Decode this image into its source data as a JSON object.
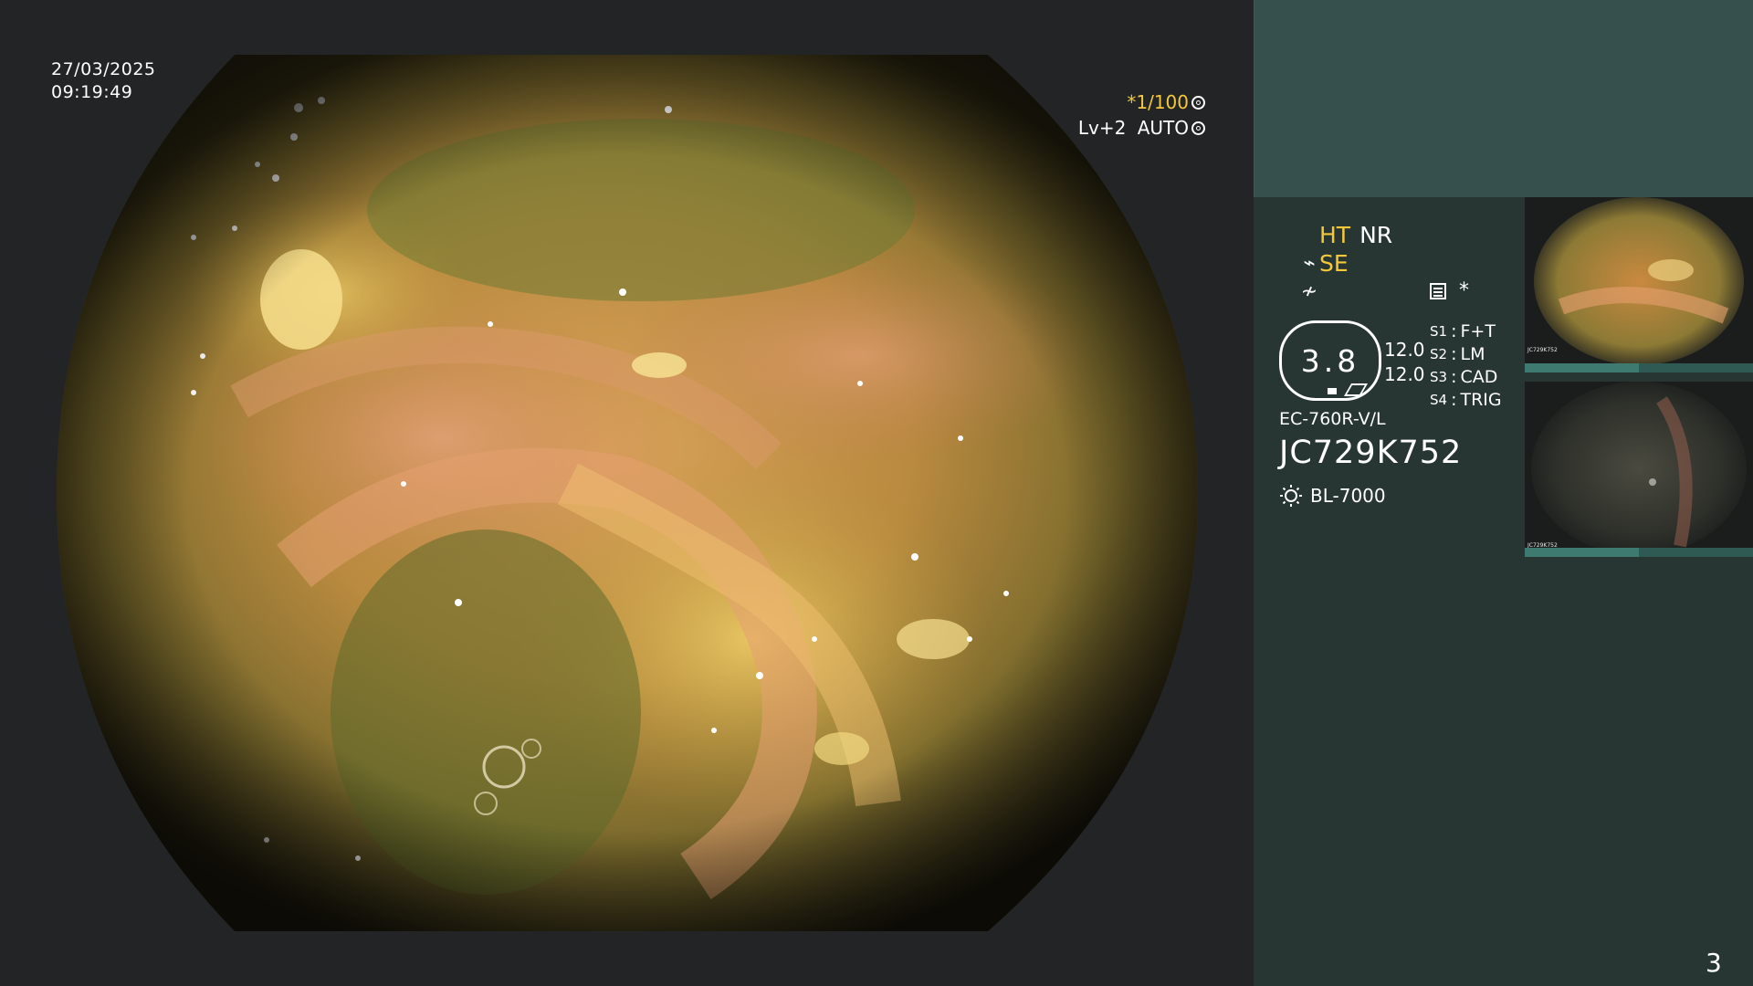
{
  "timestamp": {
    "date": "27/03/2025",
    "time": "09:19:49"
  },
  "shutter": {
    "speed": "*1/100",
    "level": "Lv+2",
    "mode": "AUTO"
  },
  "modes": {
    "ht": "HT",
    "nr": "NR",
    "se": "SE"
  },
  "settings_icons": {
    "star": "*"
  },
  "zoom": {
    "value": "3.8",
    "val1": "12.0",
    "val2": "12.0"
  },
  "switches": [
    {
      "key": "S1",
      "value": "F+T"
    },
    {
      "key": "S2",
      "value": "LM"
    },
    {
      "key": "S3",
      "value": "CAD"
    },
    {
      "key": "S4",
      "value": "TRIG"
    }
  ],
  "scope": {
    "model": "EC-760R-V/L",
    "serial": "JC729K752",
    "light_source": "BL-7000"
  },
  "thumbnails": [
    {
      "label": "JC729K752",
      "index": "3"
    },
    {
      "label": "JC729K752",
      "index": "1"
    }
  ],
  "page_number": "3",
  "colors": {
    "background": "#222426",
    "panel": "#273533",
    "header_band": "#36514d",
    "accent_yellow": "#f5c83a"
  }
}
